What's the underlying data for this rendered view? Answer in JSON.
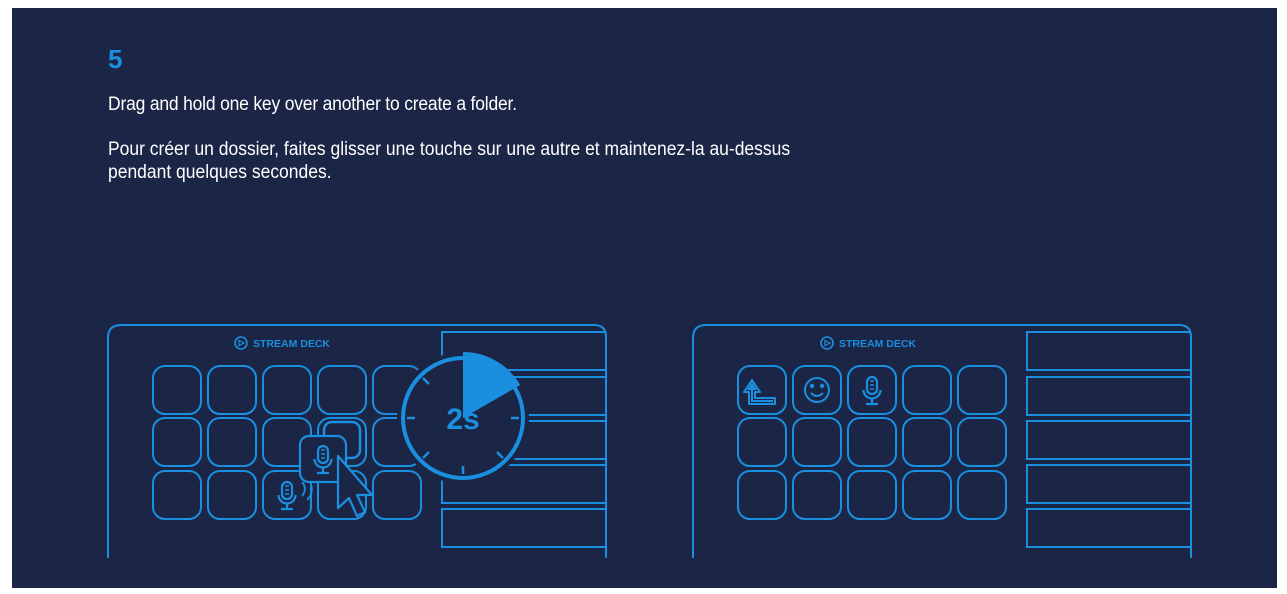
{
  "step_number": "5",
  "instruction_en": "Drag and hold one key over another to create a folder.",
  "instruction_fr_line1": "Pour créer un dossier, faites glisser une touche sur une autre et maintenez-la au-dessus",
  "instruction_fr_line2": "pendant quelques secondes.",
  "device_left": {
    "brand": "STREAM DECK",
    "timer_label": "2s",
    "icons": [
      "elgato-logo-icon",
      "microphone-icon",
      "microphone-icon",
      "mouse-cursor-icon",
      "stopwatch-icon"
    ]
  },
  "device_right": {
    "brand": "STREAM DECK",
    "icons": [
      "elgato-logo-icon",
      "folder-back-arrow-icon",
      "smiley-icon",
      "microphone-icon"
    ]
  },
  "colors": {
    "background": "#1b2545",
    "accent": "#1a8fe0",
    "text": "#ffffff"
  }
}
